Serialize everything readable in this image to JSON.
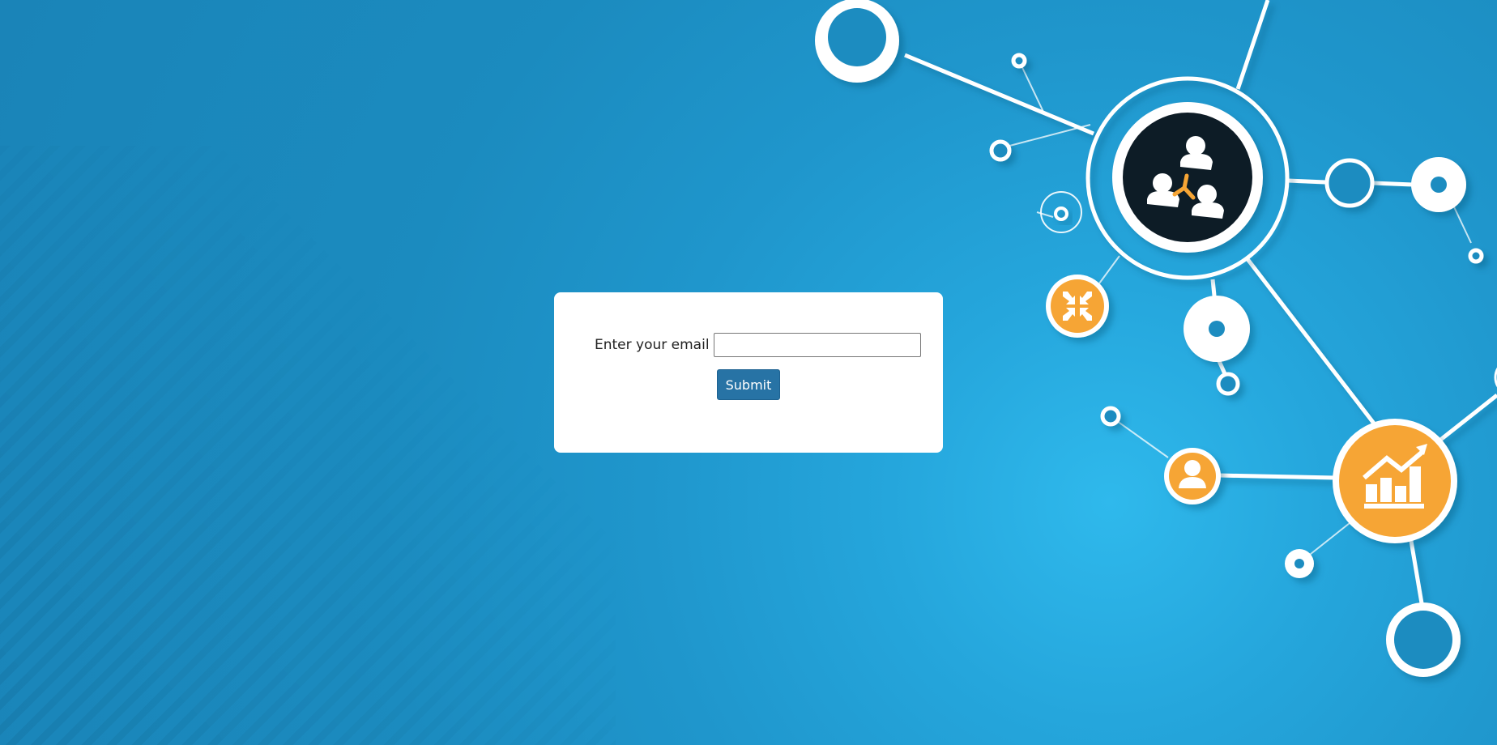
{
  "form": {
    "email_label": "Enter your email",
    "email_value": "",
    "email_placeholder": "",
    "submit_label": "Submit"
  },
  "decor": {
    "background_color": "#1c8cc0",
    "accent_orange": "#f6a535",
    "hub_dark": "#111a26",
    "icons": [
      "people-network-icon",
      "compress-arrows-icon",
      "user-icon",
      "growth-chart-icon"
    ]
  }
}
